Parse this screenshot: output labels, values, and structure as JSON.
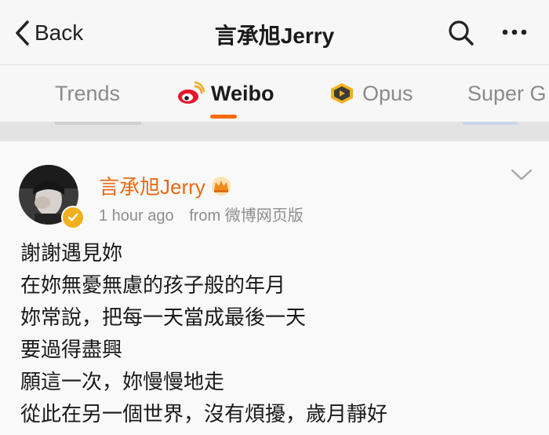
{
  "header": {
    "back_label": "Back",
    "title": "言承旭Jerry"
  },
  "tabs": [
    {
      "label": "Trends",
      "active": false
    },
    {
      "label": "Weibo",
      "active": true
    },
    {
      "label": "Opus",
      "active": false
    },
    {
      "label": "Super G",
      "active": false
    }
  ],
  "colors": {
    "accent": "#ff6a00",
    "author": "#e86a14",
    "verified": "#f2b01e"
  },
  "post": {
    "author": "言承旭Jerry",
    "time": "1 hour ago",
    "source": "from 微博网页版",
    "lines": [
      "謝謝遇見妳",
      "在妳無憂無慮的孩子般的年月",
      "妳常說，把每一天當成最後一天",
      "要過得盡興",
      "願這一次，妳慢慢地走",
      "從此在另一個世界，沒有煩擾，歲月靜好"
    ]
  },
  "icons": {
    "back": "chevron-left-icon",
    "search": "search-icon",
    "more": "more-icon",
    "weibo": "weibo-logo-icon",
    "opus": "opus-icon",
    "crown": "crown-icon",
    "verified": "verified-badge-icon",
    "expand": "chevron-down-icon"
  }
}
